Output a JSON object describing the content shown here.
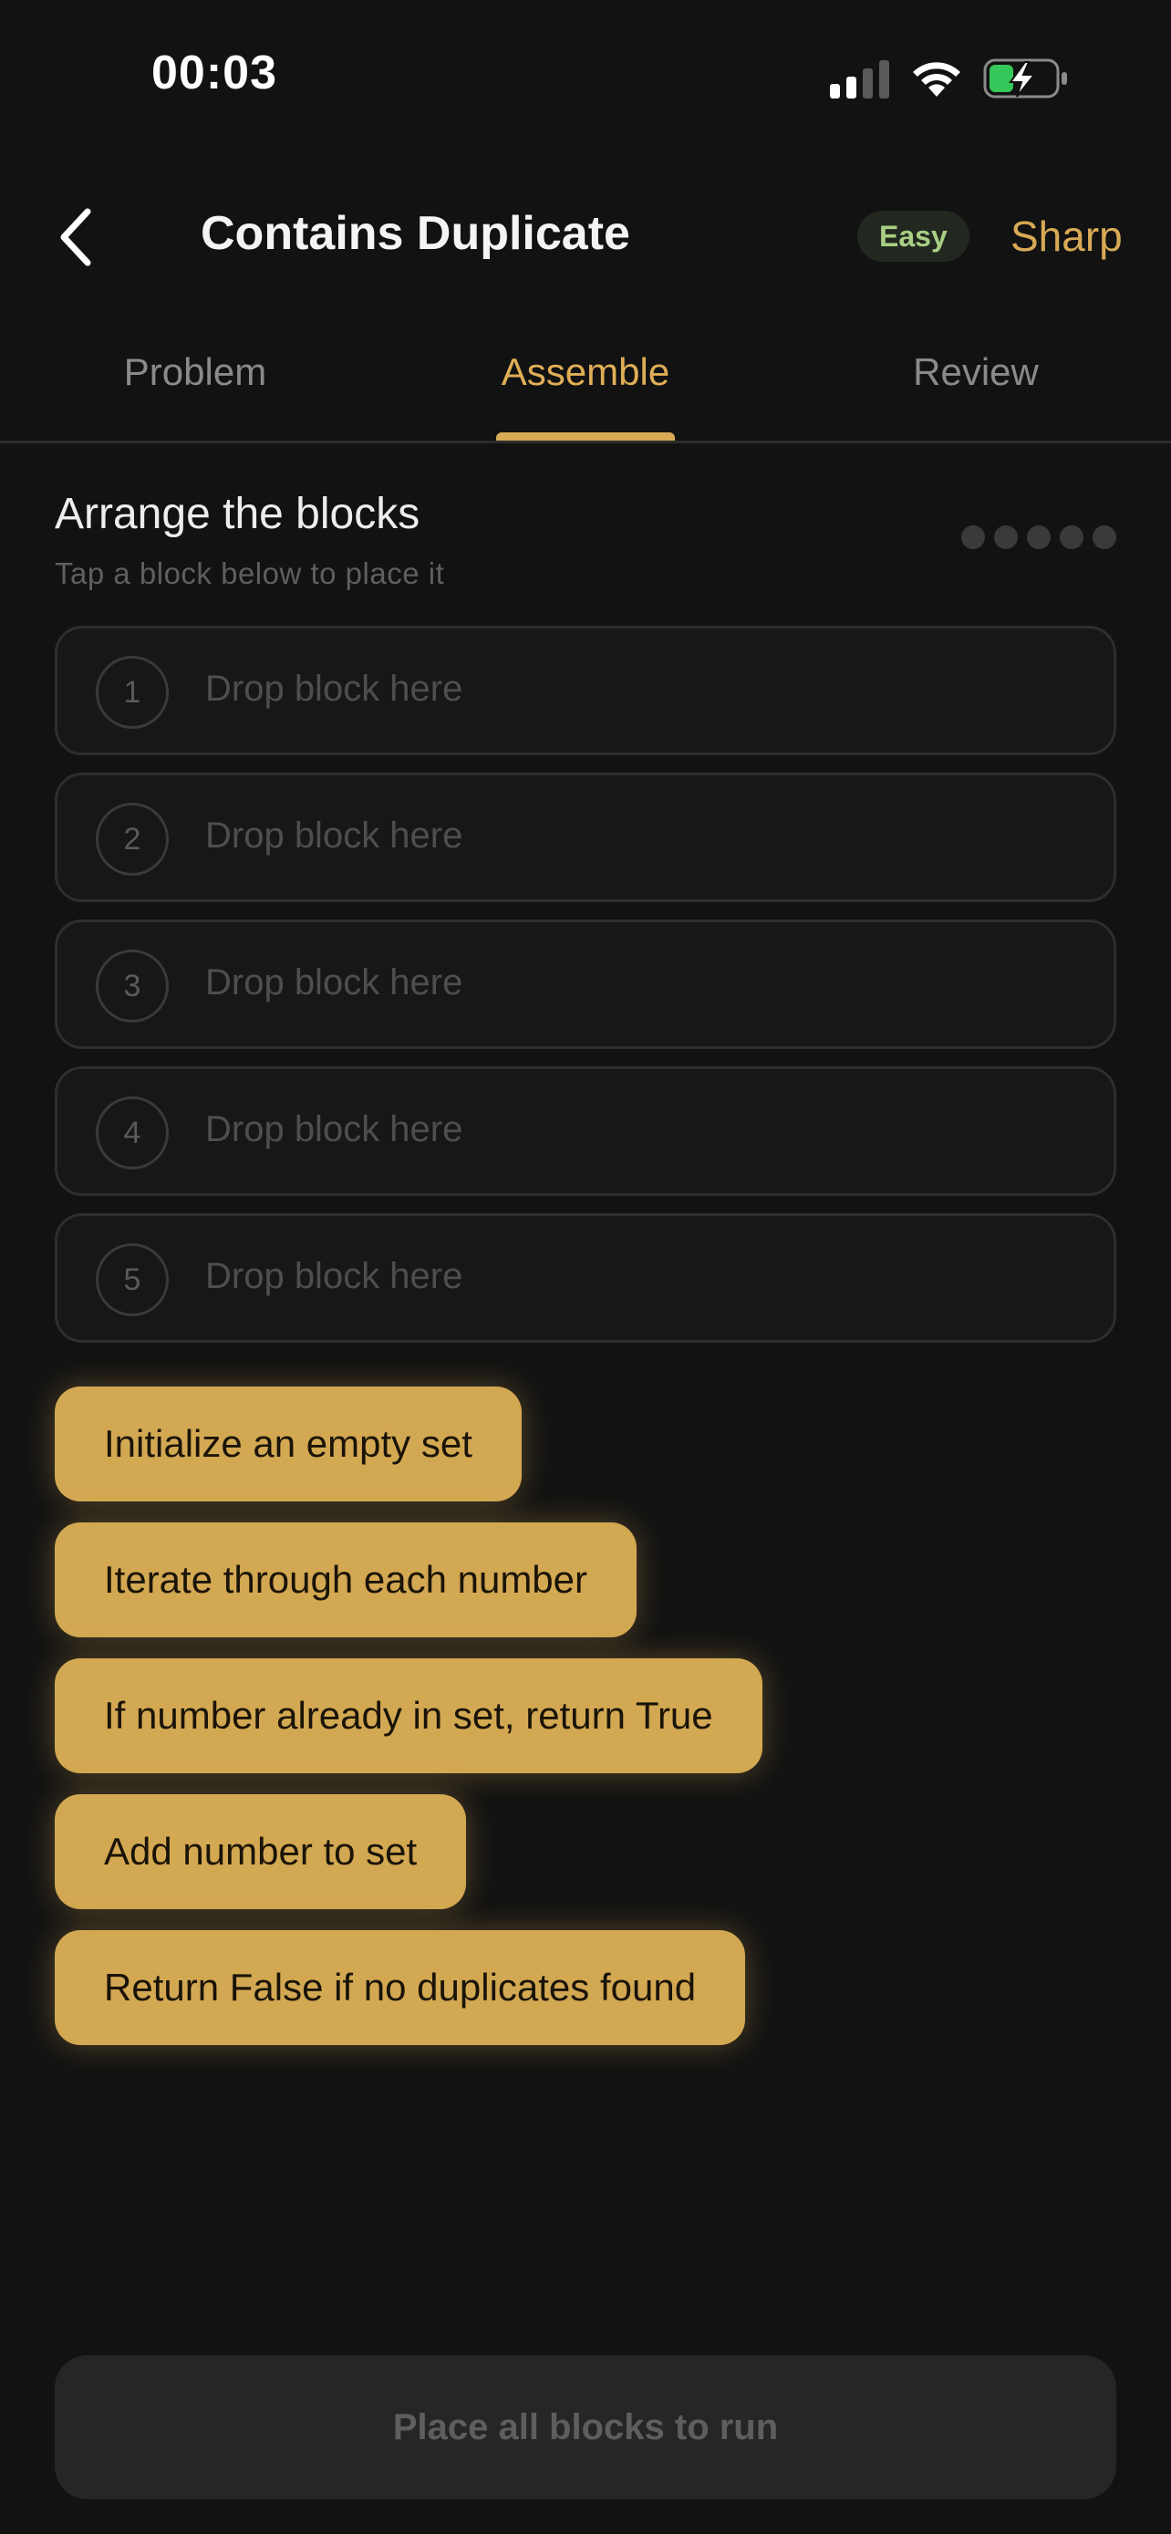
{
  "status_bar": {
    "time": "00:03"
  },
  "header": {
    "title": "Contains Duplicate",
    "difficulty": "Easy",
    "mode": "Sharp"
  },
  "tabs": [
    {
      "label": "Problem"
    },
    {
      "label": "Assemble",
      "active": true
    },
    {
      "label": "Review"
    }
  ],
  "section": {
    "title": "Arrange the blocks",
    "subtitle": "Tap a block below to place it",
    "progress_dots": 5,
    "placed_count": 0
  },
  "slots": [
    {
      "number": "1",
      "placeholder": "Drop block here"
    },
    {
      "number": "2",
      "placeholder": "Drop block here"
    },
    {
      "number": "3",
      "placeholder": "Drop block here"
    },
    {
      "number": "4",
      "placeholder": "Drop block here"
    },
    {
      "number": "5",
      "placeholder": "Drop block here"
    }
  ],
  "blocks": [
    {
      "label": "Initialize an empty set"
    },
    {
      "label": "Iterate through each number"
    },
    {
      "label": "If number already in set, return True"
    },
    {
      "label": "Add number to set"
    },
    {
      "label": "Return False if no duplicates found"
    }
  ],
  "run_button": {
    "label": "Place all blocks to run"
  },
  "colors": {
    "accent": "#d8aa55",
    "block": "#d3a852",
    "background": "#121212",
    "easy_badge": "#a8cf83"
  }
}
